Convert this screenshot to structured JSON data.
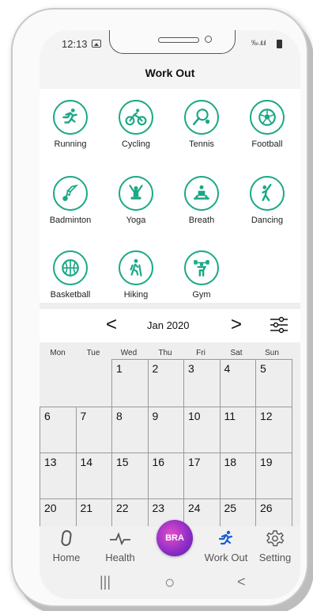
{
  "status": {
    "time": "12:13",
    "signal": "‰ .ıl.ıl"
  },
  "header": {
    "title": "Work Out"
  },
  "activities": [
    {
      "label": "Running",
      "icon": "running-icon"
    },
    {
      "label": "Cycling",
      "icon": "cycling-icon"
    },
    {
      "label": "Tennis",
      "icon": "tennis-icon"
    },
    {
      "label": "Football",
      "icon": "football-icon"
    },
    {
      "label": "Badminton",
      "icon": "badminton-icon"
    },
    {
      "label": "Yoga",
      "icon": "yoga-icon"
    },
    {
      "label": "Breath",
      "icon": "breath-icon"
    },
    {
      "label": "Dancing",
      "icon": "dancing-icon"
    },
    {
      "label": "Basketball",
      "icon": "basketball-icon"
    },
    {
      "label": "Hiking",
      "icon": "hiking-icon"
    },
    {
      "label": "Gym",
      "icon": "gym-icon"
    }
  ],
  "calendar": {
    "prev": "<",
    "next": ">",
    "month": "Jan 2020",
    "weekdays": [
      "Mon",
      "Tue",
      "Wed",
      "Thu",
      "Fri",
      "Sat",
      "Sun"
    ],
    "days": [
      "1",
      "2",
      "3",
      "4",
      "5",
      "6",
      "7",
      "8",
      "9",
      "10",
      "11",
      "12",
      "13",
      "14",
      "15",
      "16",
      "17",
      "18",
      "19",
      "20",
      "21",
      "22",
      "23",
      "24",
      "25",
      "26"
    ]
  },
  "tabs": {
    "home": "Home",
    "health": "Health",
    "center": "BRA",
    "workout": "Work Out",
    "setting": "Setting"
  },
  "nav": {
    "recent": "|||",
    "home": "○",
    "back": "<"
  },
  "colors": {
    "accent": "#1aa886",
    "active_tab": "#1a5fd0",
    "center_button": "#a23ad0"
  }
}
